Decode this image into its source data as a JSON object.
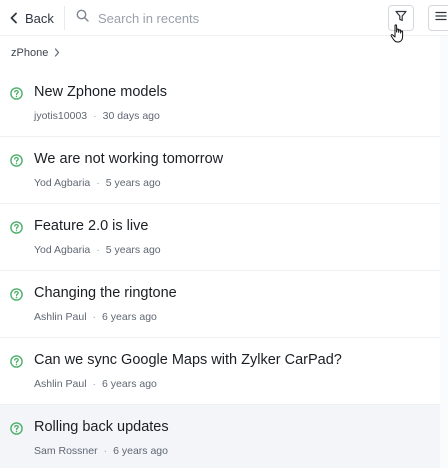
{
  "header": {
    "back_label": "Back",
    "search_placeholder": "Search in recents"
  },
  "breadcrumb": {
    "label": "zPhone"
  },
  "colors": {
    "status_icon": "#4caf6a",
    "active_row_bg": "#f3f5f9"
  },
  "items": [
    {
      "title": "New Zphone models",
      "author": "jyotis10003",
      "time": "30 days ago"
    },
    {
      "title": "We are not working tomorrow",
      "author": "Yod Agbaria",
      "time": "5 years ago"
    },
    {
      "title": "Feature 2.0 is live",
      "author": "Yod Agbaria",
      "time": "5 years ago"
    },
    {
      "title": "Changing the ringtone",
      "author": "Ashlin Paul",
      "time": "6 years ago"
    },
    {
      "title": "Can we sync Google Maps with Zylker CarPad?",
      "author": "Ashlin Paul",
      "time": "6 years ago"
    },
    {
      "title": "Rolling back updates",
      "author": "Sam Rossner",
      "time": "6 years ago"
    }
  ],
  "separator": "·"
}
